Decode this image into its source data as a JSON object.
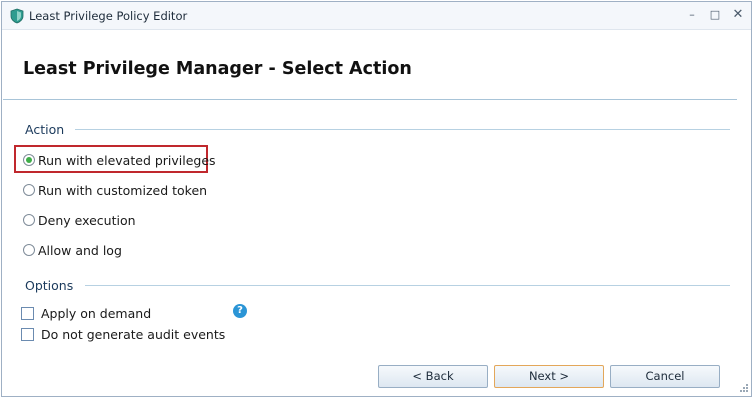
{
  "window": {
    "title": "Least Privilege Policy Editor",
    "controls": {
      "minimize": "–",
      "maximize": "□",
      "close": "✕"
    }
  },
  "header": {
    "title": "Least Privilege Manager - Select Action"
  },
  "action": {
    "label": "Action",
    "options": [
      {
        "label": "Run with elevated privileges",
        "selected": true
      },
      {
        "label": "Run with customized token",
        "selected": false
      },
      {
        "label": "Deny execution",
        "selected": false
      },
      {
        "label": "Allow and log",
        "selected": false
      }
    ]
  },
  "options": {
    "label": "Options",
    "items": [
      {
        "label": "Apply on demand",
        "checked": false
      },
      {
        "label": "Do not generate audit events",
        "checked": false
      }
    ],
    "help_glyph": "?"
  },
  "buttons": {
    "back": "<  Back",
    "next": "Next  >",
    "cancel": "Cancel"
  },
  "colors": {
    "accent_selected": "#3fae49",
    "highlight": "#c0282d",
    "help": "#2b95d6",
    "default_button_border": "#e3a75a"
  },
  "icons": {
    "app": "shield-icon",
    "help": "help-icon",
    "resize": "resize-grip-icon"
  }
}
